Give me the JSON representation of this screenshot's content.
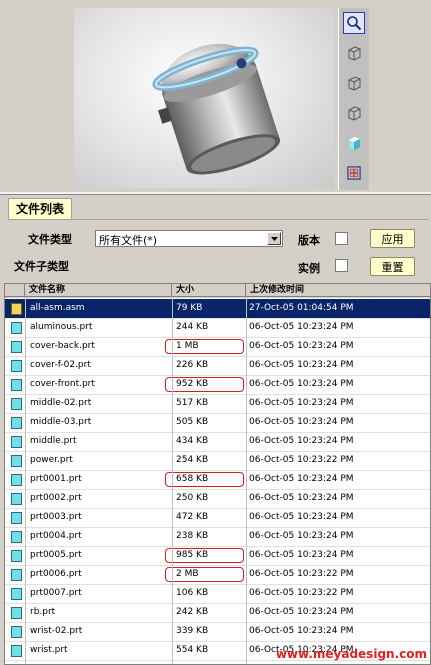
{
  "filter": {
    "tab_label": "文件列表",
    "file_type_label": "文件类型",
    "file_type_value": "所有文件(*)",
    "file_subtype_label": "文件子类型",
    "version_label": "版本",
    "instance_label": "实例",
    "apply_label": "应用",
    "reset_label": "重置"
  },
  "table": {
    "headers": [
      "文件名称",
      "大小",
      "上次修改时间"
    ],
    "rows": [
      {
        "name": "all-asm.asm",
        "size": "79 KB",
        "modified": "27-Oct-05 01:04:54 PM",
        "type": "asm",
        "selected": true
      },
      {
        "name": "aluminous.prt",
        "size": "244 KB",
        "modified": "06-Oct-05 10:23:24 PM",
        "type": "prt"
      },
      {
        "name": "cover-back.prt",
        "size": "1 MB",
        "modified": "06-Oct-05 10:23:24 PM",
        "type": "prt",
        "circled": true
      },
      {
        "name": "cover-f-02.prt",
        "size": "226 KB",
        "modified": "06-Oct-05 10:23:24 PM",
        "type": "prt"
      },
      {
        "name": "cover-front.prt",
        "size": "952 KB",
        "modified": "06-Oct-05 10:23:24 PM",
        "type": "prt",
        "circled": true
      },
      {
        "name": "middle-02.prt",
        "size": "517 KB",
        "modified": "06-Oct-05 10:23:24 PM",
        "type": "prt"
      },
      {
        "name": "middle-03.prt",
        "size": "505 KB",
        "modified": "06-Oct-05 10:23:24 PM",
        "type": "prt"
      },
      {
        "name": "middle.prt",
        "size": "434 KB",
        "modified": "06-Oct-05 10:23:24 PM",
        "type": "prt"
      },
      {
        "name": "power.prt",
        "size": "254 KB",
        "modified": "06-Oct-05 10:23:22 PM",
        "type": "prt"
      },
      {
        "name": "prt0001.prt",
        "size": "658 KB",
        "modified": "06-Oct-05 10:23:24 PM",
        "type": "prt",
        "circled": true
      },
      {
        "name": "prt0002.prt",
        "size": "250 KB",
        "modified": "06-Oct-05 10:23:24 PM",
        "type": "prt"
      },
      {
        "name": "prt0003.prt",
        "size": "472 KB",
        "modified": "06-Oct-05 10:23:24 PM",
        "type": "prt"
      },
      {
        "name": "prt0004.prt",
        "size": "238 KB",
        "modified": "06-Oct-05 10:23:24 PM",
        "type": "prt"
      },
      {
        "name": "prt0005.prt",
        "size": "985 KB",
        "modified": "06-Oct-05 10:23:24 PM",
        "type": "prt",
        "circled": true
      },
      {
        "name": "prt0006.prt",
        "size": "2 MB",
        "modified": "06-Oct-05 10:23:22 PM",
        "type": "prt",
        "circled": true
      },
      {
        "name": "prt0007.prt",
        "size": "106 KB",
        "modified": "06-Oct-05 10:23:22 PM",
        "type": "prt"
      },
      {
        "name": "rb.prt",
        "size": "242 KB",
        "modified": "06-Oct-05 10:23:24 PM",
        "type": "prt"
      },
      {
        "name": "wrist-02.prt",
        "size": "339 KB",
        "modified": "06-Oct-05 10:23:24 PM",
        "type": "prt"
      },
      {
        "name": "wrist.prt",
        "size": "554 KB",
        "modified": "06-Oct-05 10:23:24 PM",
        "type": "prt"
      }
    ]
  },
  "watermark": "www.meyadesign.com",
  "colors": {
    "selection": "#0a246a",
    "highlight": "#d02020",
    "button_bg": "#ffffcc",
    "prt_icon": "#6fe0e6",
    "asm_icon": "#f2d45c"
  },
  "icons": [
    "zoom-icon",
    "wireframe-cube-icon",
    "hidden-line-cube-icon",
    "no-hidden-cube-icon",
    "shaded-cube-icon",
    "reorient-icon"
  ]
}
